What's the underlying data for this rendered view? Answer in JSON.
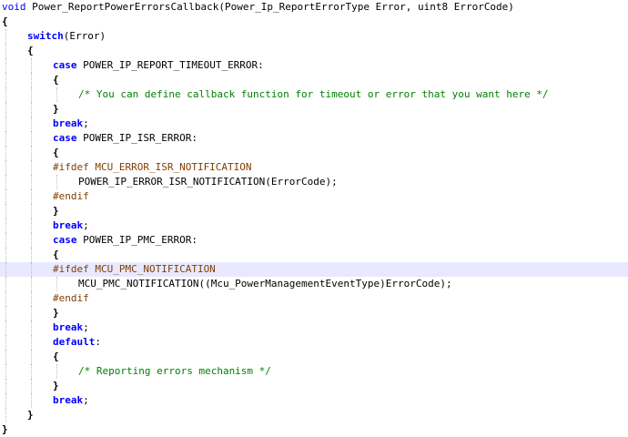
{
  "editor": {
    "current_line_index": 18,
    "lines": [
      {
        "indent": 0,
        "tokens": [
          {
            "t": "kw",
            "v": "void"
          },
          {
            "t": "plain",
            "v": " Power_ReportPowerErrorsCallback(Power_Ip_ReportErrorType Error, uint8 ErrorCode)"
          }
        ]
      },
      {
        "indent": 0,
        "tokens": [
          {
            "t": "punct",
            "v": "{"
          }
        ]
      },
      {
        "indent": 1,
        "tokens": [
          {
            "t": "kwb",
            "v": "switch"
          },
          {
            "t": "plain",
            "v": "(Error)"
          }
        ]
      },
      {
        "indent": 1,
        "tokens": [
          {
            "t": "punct",
            "v": "{"
          }
        ]
      },
      {
        "indent": 2,
        "tokens": [
          {
            "t": "kwb",
            "v": "case"
          },
          {
            "t": "plain",
            "v": " POWER_IP_REPORT_TIMEOUT_ERROR:"
          }
        ]
      },
      {
        "indent": 2,
        "tokens": [
          {
            "t": "punct",
            "v": "{"
          }
        ]
      },
      {
        "indent": 3,
        "tokens": [
          {
            "t": "com",
            "v": "/* You can define callback function for timeout or error that you want here */"
          }
        ]
      },
      {
        "indent": 2,
        "tokens": [
          {
            "t": "punct",
            "v": "}"
          }
        ]
      },
      {
        "indent": 2,
        "tokens": [
          {
            "t": "kwb",
            "v": "break"
          },
          {
            "t": "plain",
            "v": ";"
          }
        ]
      },
      {
        "indent": 2,
        "tokens": [
          {
            "t": "kwb",
            "v": "case"
          },
          {
            "t": "plain",
            "v": " POWER_IP_ISR_ERROR:"
          }
        ]
      },
      {
        "indent": 2,
        "tokens": [
          {
            "t": "punct",
            "v": "{"
          }
        ]
      },
      {
        "indent": 2,
        "tokens": [
          {
            "t": "pp",
            "v": "#ifdef MCU_ERROR_ISR_NOTIFICATION"
          }
        ]
      },
      {
        "indent": 3,
        "tokens": [
          {
            "t": "plain",
            "v": "POWER_IP_ERROR_ISR_NOTIFICATION(ErrorCode);"
          }
        ]
      },
      {
        "indent": 2,
        "tokens": [
          {
            "t": "pp",
            "v": "#endif"
          }
        ]
      },
      {
        "indent": 2,
        "tokens": [
          {
            "t": "punct",
            "v": "}"
          }
        ]
      },
      {
        "indent": 2,
        "tokens": [
          {
            "t": "kwb",
            "v": "break"
          },
          {
            "t": "plain",
            "v": ";"
          }
        ]
      },
      {
        "indent": 2,
        "tokens": [
          {
            "t": "kwb",
            "v": "case"
          },
          {
            "t": "plain",
            "v": " POWER_IP_PMC_ERROR:"
          }
        ]
      },
      {
        "indent": 2,
        "tokens": [
          {
            "t": "punct",
            "v": "{"
          }
        ]
      },
      {
        "indent": 2,
        "tokens": [
          {
            "t": "pp",
            "v": "#ifdef MCU_PMC_NOTIFICATION"
          }
        ]
      },
      {
        "indent": 3,
        "tokens": [
          {
            "t": "plain",
            "v": "MCU_PMC_NOTIFICATION((Mcu_PowerManagementEventType)ErrorCode);"
          }
        ]
      },
      {
        "indent": 2,
        "tokens": [
          {
            "t": "pp",
            "v": "#endif"
          }
        ]
      },
      {
        "indent": 2,
        "tokens": [
          {
            "t": "punct",
            "v": "}"
          }
        ]
      },
      {
        "indent": 2,
        "tokens": [
          {
            "t": "kwb",
            "v": "break"
          },
          {
            "t": "plain",
            "v": ";"
          }
        ]
      },
      {
        "indent": 2,
        "tokens": [
          {
            "t": "kwb",
            "v": "default"
          },
          {
            "t": "plain",
            "v": ":"
          }
        ]
      },
      {
        "indent": 2,
        "tokens": [
          {
            "t": "punct",
            "v": "{"
          }
        ]
      },
      {
        "indent": 3,
        "tokens": [
          {
            "t": "com",
            "v": "/* Reporting errors mechanism */"
          }
        ]
      },
      {
        "indent": 2,
        "tokens": [
          {
            "t": "punct",
            "v": "}"
          }
        ]
      },
      {
        "indent": 2,
        "tokens": [
          {
            "t": "kwb",
            "v": "break"
          },
          {
            "t": "plain",
            "v": ";"
          }
        ]
      },
      {
        "indent": 1,
        "tokens": [
          {
            "t": "punct",
            "v": "}"
          }
        ]
      },
      {
        "indent": 0,
        "tokens": [
          {
            "t": "punct",
            "v": "}"
          }
        ]
      }
    ]
  }
}
